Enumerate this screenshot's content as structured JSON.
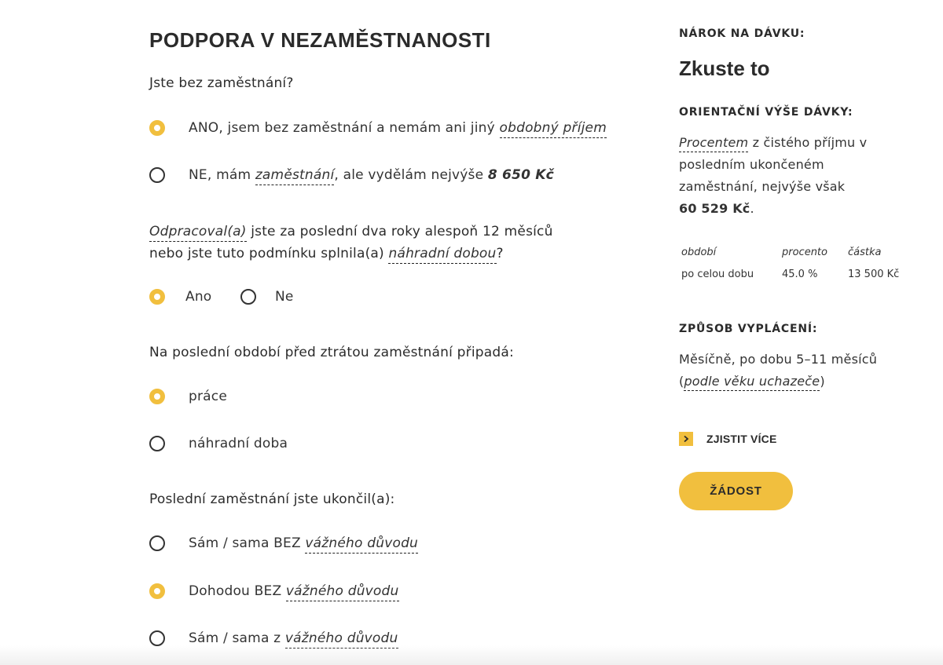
{
  "form": {
    "title": "PODPORA V NEZAMĚSTNANOSTI",
    "q1": {
      "question": "Jste bez zaměstnání?",
      "opt_yes": {
        "text": "ANO, jsem bez zaměstnání a nemám ani jiný ",
        "link": "obdobný příjem",
        "selected": true
      },
      "opt_no": {
        "text_a": "NE, mám ",
        "link": "zaměstnání",
        "text_b": ", ale vydělám nejvýše ",
        "amount": "8 650 Kč",
        "selected": false
      }
    },
    "q2": {
      "link1": "Odpracoval(a)",
      "line1": " jste za poslední dva roky alespoň 12 měsíců",
      "line2": "nebo jste tuto podmínku splnila(a) ",
      "link2": "náhradní dobou",
      "end": "?",
      "opt_yes": {
        "label": "Ano",
        "selected": true
      },
      "opt_no": {
        "label": "Ne",
        "selected": false
      }
    },
    "q3": {
      "question": "Na poslední období před ztrátou zaměstnání připadá:",
      "opt_work": {
        "label": "práce",
        "selected": true
      },
      "opt_subst": {
        "label": "náhradní doba",
        "selected": false
      }
    },
    "q4": {
      "question": "Poslední zaměstnání jste ukončil(a):",
      "opt1": {
        "text": "Sám / sama BEZ ",
        "link": "vážného důvodu",
        "selected": false
      },
      "opt2": {
        "text": "Dohodou BEZ ",
        "link": "vážného důvodu",
        "selected": true
      },
      "opt3": {
        "text": "Sám / sama z ",
        "link": "vážného důvodu",
        "selected": false
      }
    }
  },
  "sidebar": {
    "entitlement_heading": "NÁROK NA DÁVKU:",
    "entitlement_value": "Zkuste to",
    "amount_heading": "ORIENTAČNÍ VÝŠE DÁVKY:",
    "amount_link": "Procentem",
    "amount_line1": " z čistého příjmu v",
    "amount_line2": "posledním ukončeném",
    "amount_line3": "zaměstnání, nejvýše však",
    "amount_max": "60 529 Kč",
    "amount_end": ".",
    "table": {
      "headers": [
        "období",
        "procento",
        "částka"
      ],
      "rows": [
        [
          "po celou dobu",
          "45.0 %",
          "13 500 Kč"
        ]
      ]
    },
    "payment_heading": "ZPŮSOB VYPLÁCENÍ:",
    "payment_line1": "Měsíčně, po dobu 5–11 měsíců",
    "payment_open": "(",
    "payment_link": "podle věku uchazeče",
    "payment_close": ")",
    "more_label": "ZJISTIT VÍCE",
    "apply_label": "ŽÁDOST"
  },
  "colors": {
    "accent": "#f1bf3e",
    "text": "#2b2b2b"
  }
}
